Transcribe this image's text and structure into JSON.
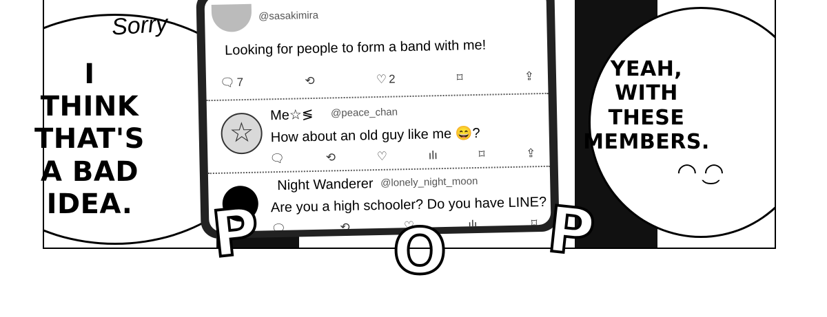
{
  "left_bubble": {
    "sorry": "Sorry",
    "line1": "I THINK",
    "line2": "THAT'S",
    "line3": "A BAD",
    "line4": "IDEA."
  },
  "right_bubble": {
    "line1": "YEAH,",
    "line2": "WITH THESE",
    "line3": "MEMBERS.",
    "face": "◠ ͜◠"
  },
  "sfx": {
    "p1": "P",
    "o": "O",
    "p2": "P"
  },
  "phone": {
    "post1": {
      "handle": "@sasakimira",
      "text": "Looking for people to form a band with me!",
      "replies": "7",
      "likes": "2"
    },
    "post2": {
      "name": "Me☆≶",
      "handle": "@peace_chan",
      "text": "How about an old guy like me 😄?"
    },
    "post3": {
      "name": "Night Wanderer",
      "handle": "@lonely_night_moon",
      "text": "Are you a high schooler? Do you have LINE?"
    }
  }
}
